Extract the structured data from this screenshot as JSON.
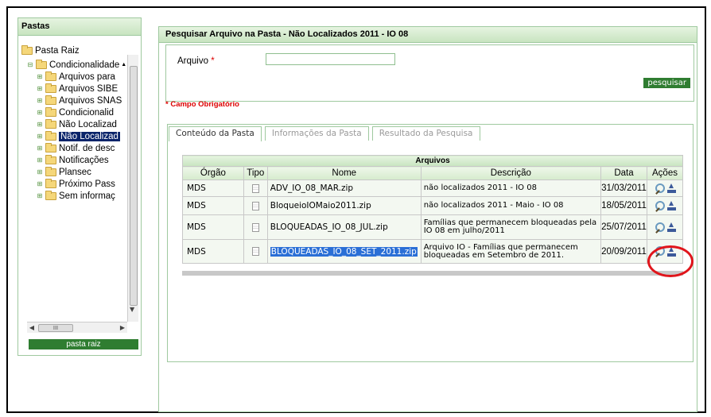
{
  "left_panel": {
    "title": "Pastas",
    "root_label": "Pasta Raiz",
    "tree": [
      {
        "label": "Condicionalidade",
        "level": 1,
        "expanded": true
      },
      {
        "label": "Arquivos para",
        "level": 2
      },
      {
        "label": "Arquivos SIBE",
        "level": 2
      },
      {
        "label": "Arquivos SNAS",
        "level": 2
      },
      {
        "label": "Condicionalid",
        "level": 2
      },
      {
        "label": "Não Localizad",
        "level": 2
      },
      {
        "label": "Não Localizad",
        "level": 2,
        "selected": true
      },
      {
        "label": "Notif. de desc",
        "level": 2
      },
      {
        "label": "Notificações",
        "level": 2
      },
      {
        "label": "Plansec",
        "level": 2
      },
      {
        "label": "Próximo Pass",
        "level": 2
      },
      {
        "label": "Sem informaç",
        "level": 2
      }
    ],
    "root_button": "pasta raiz"
  },
  "search": {
    "title": "Pesquisar Arquivo na Pasta - Não Localizados 2011 - IO 08",
    "field_label": "Arquivo",
    "required_mark": "*",
    "field_value": "",
    "button": "pesquisar",
    "required_note": "* Campo Obrigatório"
  },
  "tabs": [
    "Conteúdo da Pasta",
    "Informações da Pasta",
    "Resultado da Pesquisa"
  ],
  "table": {
    "caption": "Arquivos",
    "headers": [
      "Órgão",
      "Tipo",
      "Nome",
      "Descrição",
      "Data",
      "Ações"
    ],
    "rows": [
      {
        "orgao": "MDS",
        "nome": "ADV_IO_08_MAR.zip",
        "descricao": "não localizados 2011 - IO 08",
        "data": "31/03/2011"
      },
      {
        "orgao": "MDS",
        "nome": "BloqueioIOMaio2011.zip",
        "descricao": "não localizados 2011 - Maio - IO 08",
        "data": "18/05/2011"
      },
      {
        "orgao": "MDS",
        "nome": "BLOQUEADAS_IO_08_JUL.zip",
        "descricao": "Famílias que permanecem bloqueadas pela IO 08 em julho/2011",
        "data": "25/07/2011"
      },
      {
        "orgao": "MDS",
        "nome": "BLOQUEADAS_IO_08_SET_2011.zip",
        "descricao": "Arquivo IO - Famílias que permanecem bloqueadas em Setembro de 2011.",
        "data": "20/09/2011",
        "highlighted": true
      }
    ]
  },
  "colors": {
    "accent_green": "#2f7d31",
    "selection_blue": "#0a246a",
    "annotation_red": "#e0151b"
  },
  "icons": {
    "folder": "folder-icon",
    "file": "document-icon",
    "view": "magnifier-icon",
    "download": "download-icon"
  }
}
